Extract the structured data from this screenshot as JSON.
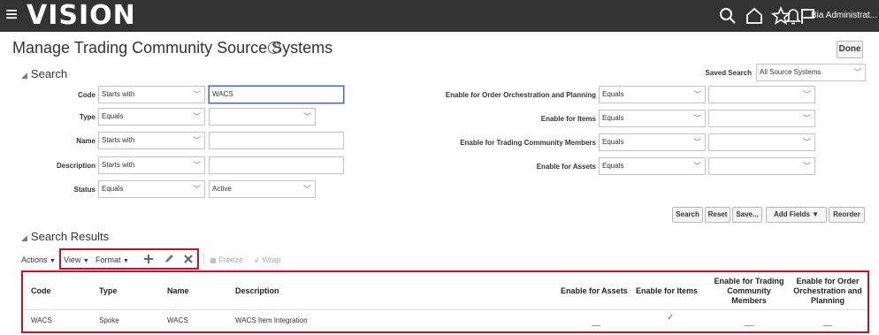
{
  "header": {
    "logo": "VISION",
    "user": "Bia Administrat...",
    "icons": [
      "search-icon",
      "home-icon",
      "star-icon",
      "flag-icon",
      "bell-icon"
    ]
  },
  "page": {
    "title": "Manage Trading Community Source Systems",
    "done_label": "Done"
  },
  "search": {
    "heading": "Search",
    "saved_search_label": "Saved Search",
    "saved_search_value": "All Source Systems",
    "fields": {
      "code": {
        "label": "Code",
        "operator": "Starts with",
        "value": "WACS"
      },
      "type": {
        "label": "Type",
        "operator": "Equals",
        "value": ""
      },
      "name": {
        "label": "Name",
        "operator": "Starts with",
        "value": ""
      },
      "description": {
        "label": "Description",
        "operator": "Starts with",
        "value": ""
      },
      "status": {
        "label": "Status",
        "operator": "Equals",
        "value": "Active"
      },
      "order_orch": {
        "label": "Enable for Order Orchestration and Planning",
        "operator": "Equals",
        "value": ""
      },
      "items": {
        "label": "Enable for Items",
        "operator": "Equals",
        "value": ""
      },
      "tcm": {
        "label": "Enable for Trading Community Members",
        "operator": "Equals",
        "value": ""
      },
      "assets": {
        "label": "Enable for Assets",
        "operator": "Equals",
        "value": ""
      }
    },
    "buttons": {
      "search": "Search",
      "reset": "Reset",
      "save": "Save...",
      "add_fields": "Add Fields",
      "reorder": "Reorder"
    }
  },
  "results": {
    "heading": "Search Results",
    "toolbar": {
      "actions": "Actions",
      "view": "View",
      "format": "Format",
      "freeze": "Freeze",
      "wrap": "Wrap"
    },
    "columns": {
      "code": "Code",
      "type": "Type",
      "name": "Name",
      "description": "Description",
      "assets": "Enable for Assets",
      "items": "Enable for Items",
      "tcm_l1": "Enable for Trading",
      "tcm_l2": "Community",
      "tcm_l3": "Members",
      "oo_l1": "Enable for Order",
      "oo_l2": "Orchestration and",
      "oo_l3": "Planning"
    },
    "rows": [
      {
        "code": "WACS",
        "type": "Spoke",
        "name": "WACS",
        "description": "WACS Item Integration",
        "assets": false,
        "items": true,
        "tcm": false,
        "order_orch": false
      }
    ]
  },
  "colors": {
    "topbar": "#333333",
    "highlight": "#c8102e",
    "check": "#3a6ea5"
  }
}
